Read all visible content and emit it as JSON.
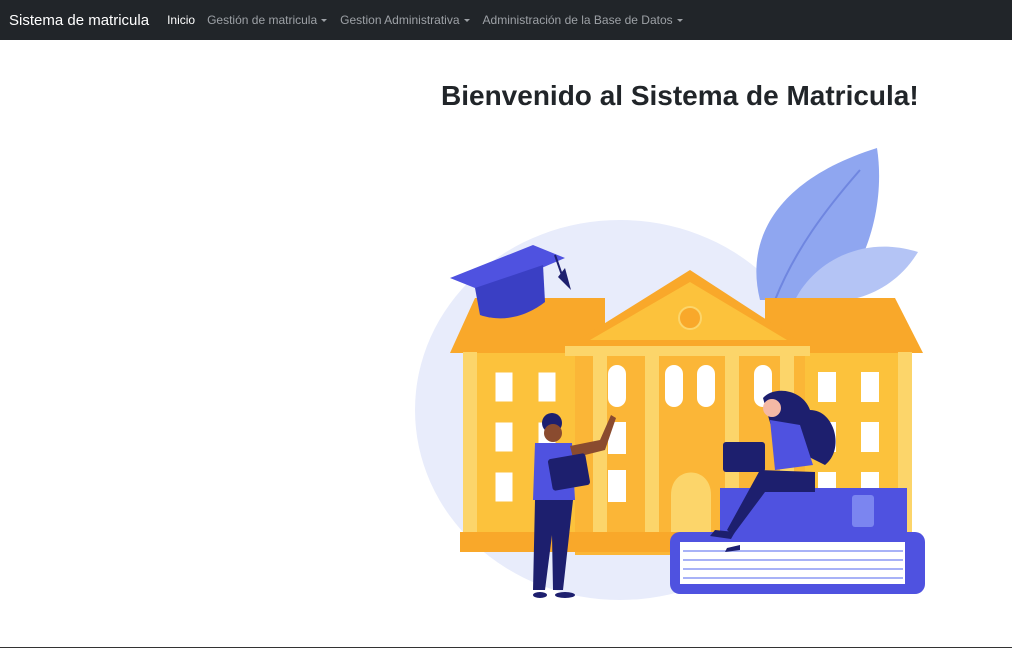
{
  "navbar": {
    "brand": "Sistema de matricula",
    "items": [
      {
        "label": "Inicio",
        "active": true,
        "dropdown": false
      },
      {
        "label": "Gestión de matricula",
        "active": false,
        "dropdown": true
      },
      {
        "label": "Gestion Administrativa",
        "active": false,
        "dropdown": true
      },
      {
        "label": "Administración de la Base de Datos",
        "active": false,
        "dropdown": true
      }
    ]
  },
  "main": {
    "welcome_title": "Bienvenido al Sistema de Matricula!"
  },
  "colors": {
    "navbar_bg": "#212529",
    "building_orange": "#f9a82a",
    "building_yellow": "#fcc23c",
    "accent_blue": "#4f52e0",
    "background_blob": "#e8ecfb"
  }
}
